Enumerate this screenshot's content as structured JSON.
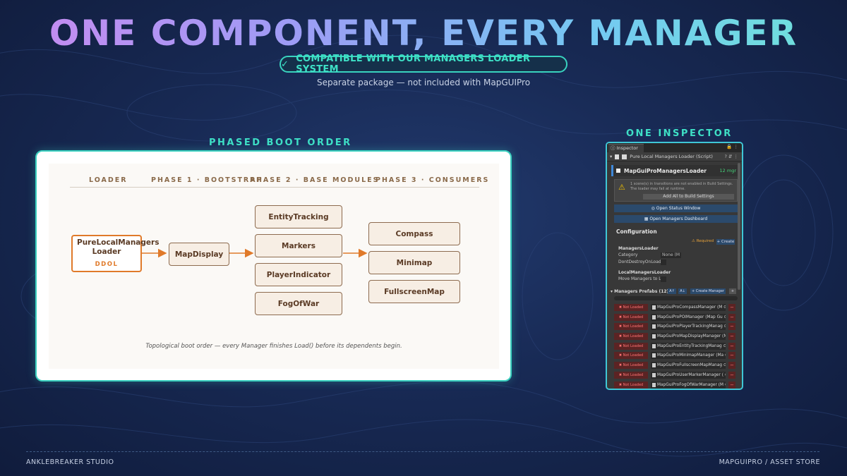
{
  "header": {
    "title": "ONE COMPONENT, EVERY MANAGER",
    "compat_label": "COMPATIBLE WITH OUR MANAGERS LOADER SYSTEM",
    "subtitle": "Separate package — not included with MapGUIPro"
  },
  "diagram": {
    "section_title": "PHASED BOOT ORDER",
    "phases": [
      "LOADER",
      "PHASE 1 · BOOTSTRAP",
      "PHASE 2 · BASE MODULES",
      "PHASE 3 · CONSUMERS"
    ],
    "loader": {
      "name": "PureLocalManagers Loader",
      "tag": "DDOL"
    },
    "phase1": [
      "MapDisplay"
    ],
    "phase2": [
      "EntityTracking",
      "Markers",
      "PlayerIndicator",
      "FogOfWar"
    ],
    "phase3": [
      "Compass",
      "Minimap",
      "FullscreenMap"
    ],
    "caption": "Topological boot order — every Manager finishes Load() before its dependents begin.",
    "accent_color": "#e07a2a"
  },
  "inspector": {
    "section_title": "ONE INSPECTOR",
    "tab_label": "Inspector",
    "component_title": "Pure Local Managers Loader (Script)",
    "asset_name": "MapGuiProManagersLoader",
    "asset_size": "12 mgr",
    "warning_text": "1 scene(s) in transitions are not enabled in Build Settings. The loader may fail at runtime.",
    "warning_button": "Add All to Build Settings",
    "status_button": "Open Status Window",
    "dashboard_button": "Open Managers Dashboard",
    "configuration_label": "Configuration",
    "required_label": "Required",
    "create_label": "+ Create",
    "managers_loader_group": "ManagersLoader",
    "category_label": "Category",
    "category_value": "None (M",
    "ddol_label": "DontDestroyOnLoad",
    "local_loader_group": "LocalManagersLoader",
    "move_label": "Move Managers to Li",
    "prefabs_header": "Managers Prefabs (12)",
    "sort_az": "A↑",
    "sort_za": "A↓",
    "create_manager": "+ Create Manager",
    "add_plus": "+",
    "not_loaded_label": "Not Loaded",
    "remove_label": "−",
    "prefabs": [
      "MapGuiProCompassManager (M",
      "MapGuiProPOIManager (Map Gu",
      "MapGuiProPlayerTrackingManag",
      "MapGuiProMapDisplayManager (M",
      "MapGuiProEntityTrackingManag",
      "MapGuiProMinimapManager (Ma",
      "MapGuiProFullscreenMapManag",
      "MapGuiProUserMarkerManager (",
      "MapGuiProFogOfWarManager (M"
    ]
  },
  "footer": {
    "left": "ANKLEBREAKER  STUDIO",
    "right": "MAPGUIPRO  /  ASSET STORE"
  }
}
